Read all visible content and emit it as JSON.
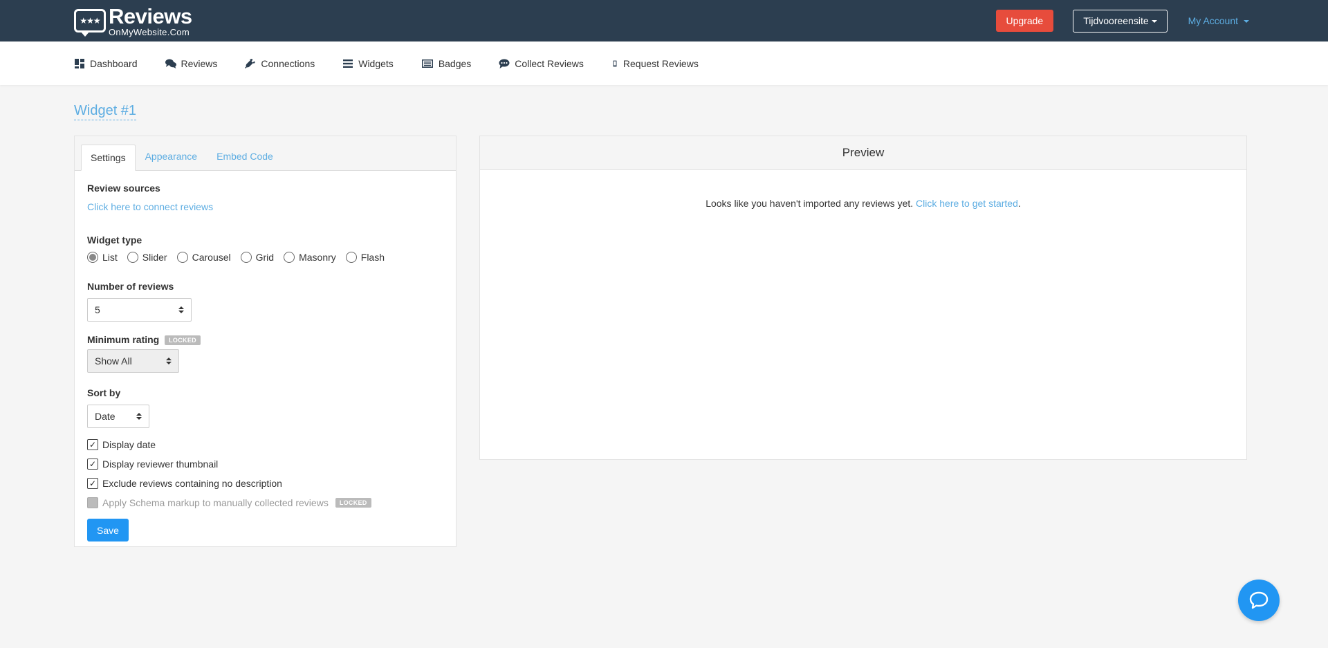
{
  "brand": {
    "badge_text": "★★★",
    "title": "Reviews",
    "subtitle": "OnMyWebsite.Com"
  },
  "topbar": {
    "upgrade_label": "Upgrade",
    "site_label": "Tijdvooreensite",
    "account_label": "My Account"
  },
  "nav": {
    "items": [
      {
        "label": "Dashboard",
        "icon": "dashboard-icon"
      },
      {
        "label": "Reviews",
        "icon": "comments-icon"
      },
      {
        "label": "Connections",
        "icon": "plug-icon"
      },
      {
        "label": "Widgets",
        "icon": "bars-icon"
      },
      {
        "label": "Badges",
        "icon": "list-alt-icon"
      },
      {
        "label": "Collect Reviews",
        "icon": "comment-dots-icon"
      },
      {
        "label": "Request Reviews",
        "icon": "mobile-icon"
      }
    ]
  },
  "page": {
    "title": "Widget #1"
  },
  "tabs": [
    {
      "label": "Settings",
      "active": true
    },
    {
      "label": "Appearance",
      "active": false
    },
    {
      "label": "Embed Code",
      "active": false
    }
  ],
  "form": {
    "review_sources_label": "Review sources",
    "connect_link": "Click here to connect reviews",
    "widget_type_label": "Widget type",
    "widget_types": [
      {
        "label": "List",
        "checked": true
      },
      {
        "label": "Slider",
        "checked": false
      },
      {
        "label": "Carousel",
        "checked": false
      },
      {
        "label": "Grid",
        "checked": false
      },
      {
        "label": "Masonry",
        "checked": false
      },
      {
        "label": "Flash",
        "checked": false
      }
    ],
    "num_reviews_label": "Number of reviews",
    "num_reviews_value": "5",
    "min_rating_label": "Minimum rating",
    "locked_badge": "LOCKED",
    "min_rating_value": "Show All",
    "sort_by_label": "Sort by",
    "sort_by_value": "Date",
    "checkboxes": [
      {
        "label": "Display date",
        "checked": true
      },
      {
        "label": "Display reviewer thumbnail",
        "checked": true
      },
      {
        "label": "Exclude reviews containing no description",
        "checked": true
      },
      {
        "label": "Apply Schema markup to manually collected reviews",
        "checked": false,
        "locked": true
      }
    ],
    "save_label": "Save"
  },
  "preview": {
    "title": "Preview",
    "message": "Looks like you haven't imported any reviews yet.",
    "link": "Click here to get started",
    "after_link": "."
  },
  "colors": {
    "topbar": "#2c3e50",
    "accent": "#5dade2",
    "upgrade": "#e74c3c",
    "primary": "#2196f3"
  }
}
